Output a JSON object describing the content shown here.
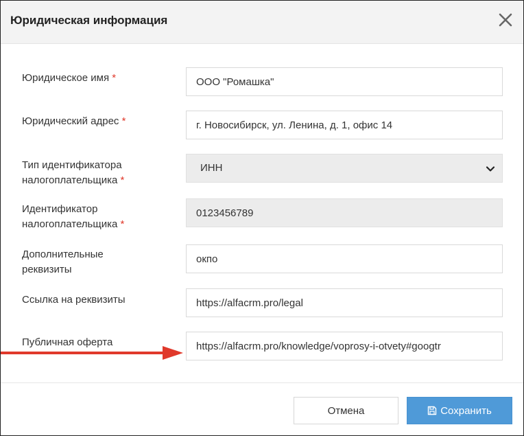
{
  "dialog": {
    "title": "Юридическая информация"
  },
  "form": {
    "required_mark": "*",
    "legal_name": {
      "label": "Юридическое имя",
      "value": "ООО \"Ромашка\""
    },
    "legal_address": {
      "label": "Юридический адрес",
      "value": "г. Новосибирск, ул. Ленина, д. 1, офис 14"
    },
    "taxpayer_id_type": {
      "label_line1": "Тип идентификатора",
      "label_line2": "налогоплательщика",
      "value": "ИНН"
    },
    "taxpayer_id": {
      "label_line1": "Идентификатор",
      "label_line2": "налогоплательщика",
      "value": "0123456789"
    },
    "extra_details": {
      "label_line1": "Дополнительные",
      "label_line2": "реквизиты",
      "value": "окпо"
    },
    "details_link": {
      "label": "Ссылка на реквизиты",
      "value": "https://alfacrm.pro/legal"
    },
    "public_offer": {
      "label": "Публичная оферта",
      "value": "https://alfacrm.pro/knowledge/voprosy-i-otvety#googtr"
    }
  },
  "footer": {
    "cancel_label": "Отмена",
    "save_label": "Сохранить"
  },
  "colors": {
    "required": "#e0392b",
    "save_button": "#4f9ad8",
    "annotation_arrow": "#e0392b"
  }
}
